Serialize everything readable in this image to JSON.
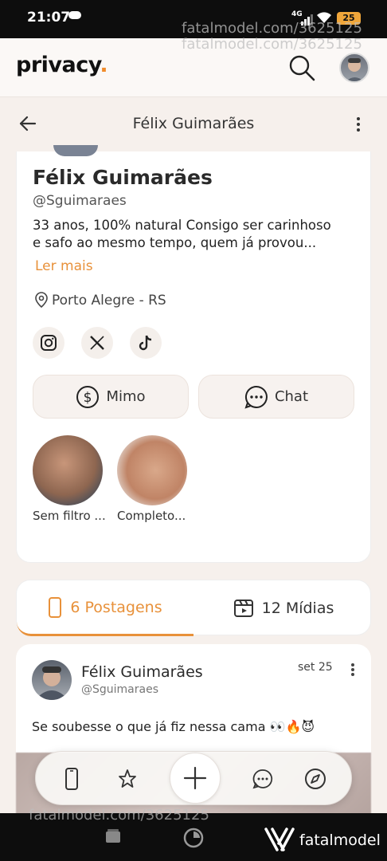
{
  "statusbar": {
    "time": "21:07",
    "network": "4G",
    "battery": "25"
  },
  "watermark": {
    "top": [
      "fatalmodel.com/3625125",
      "fatalmodel.com/3625125"
    ],
    "bottom": "fatalmodel.com/3625125",
    "brand": "fatalmodel"
  },
  "appbar": {
    "logo": "privacy",
    "logo_dot": ".",
    "search_icon": "search-icon"
  },
  "header": {
    "title": "Félix Guimarães",
    "back_icon": "arrow-left-icon",
    "more_icon": "kebab-icon"
  },
  "profile": {
    "name": "Félix Guimarães",
    "handle": "@Sguimaraes",
    "bio_line1": "33 anos, 100% natural Consigo ser carinhoso",
    "bio_line2": "e safo ao mesmo tempo, quem já provou...",
    "read_more": "Ler mais",
    "location": "Porto Alegre - RS",
    "socials": [
      "instagram-icon",
      "x-icon",
      "tiktok-icon"
    ],
    "buttons": {
      "mimo": "Mimo",
      "chat": "Chat"
    },
    "highlights": [
      {
        "label": "Sem filtro ..."
      },
      {
        "label": "Completo..."
      }
    ]
  },
  "tabs": {
    "posts": "6 Postagens",
    "media": "12 Mídias",
    "active": "posts",
    "accent": "#e8913a"
  },
  "post": {
    "name": "Félix Guimarães",
    "handle": "@Sguimaraes",
    "date": "set 25",
    "text": "Se soubesse o que já fiz nessa cama 👀🔥😈"
  },
  "bottom_nav": [
    "phone-icon",
    "star-icon",
    "plus-icon",
    "chat-icon",
    "compass-icon"
  ]
}
